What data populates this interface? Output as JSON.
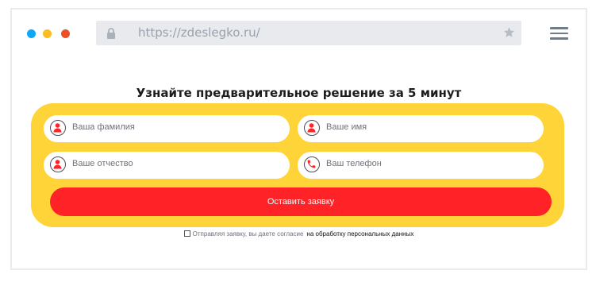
{
  "browser": {
    "window_dots": [
      "#10a5f5",
      "#fbbe22",
      "#ef4e25"
    ],
    "url": "https://zdeslegko.ru/",
    "icons": {
      "lock": "lock-icon",
      "bookmark": "star-icon",
      "menu": "hamburger-menu-icon"
    }
  },
  "page": {
    "headline": "Узнайте предварительное решение за 5 минут",
    "colors": {
      "panel": "#ffd438",
      "button": "#ff2226",
      "icon_red": "#ff2226"
    },
    "form": {
      "last_name_placeholder": "Ваша фамилия",
      "first_name_placeholder": "Ваше имя",
      "middle_name_placeholder": "Ваше отчество",
      "phone_placeholder": "Ваш телефон",
      "submit_label": "Оставить заявку"
    },
    "consent": {
      "text": "Отправляя заявку, вы даете согласие",
      "link": "на обработку персональных данных"
    }
  }
}
